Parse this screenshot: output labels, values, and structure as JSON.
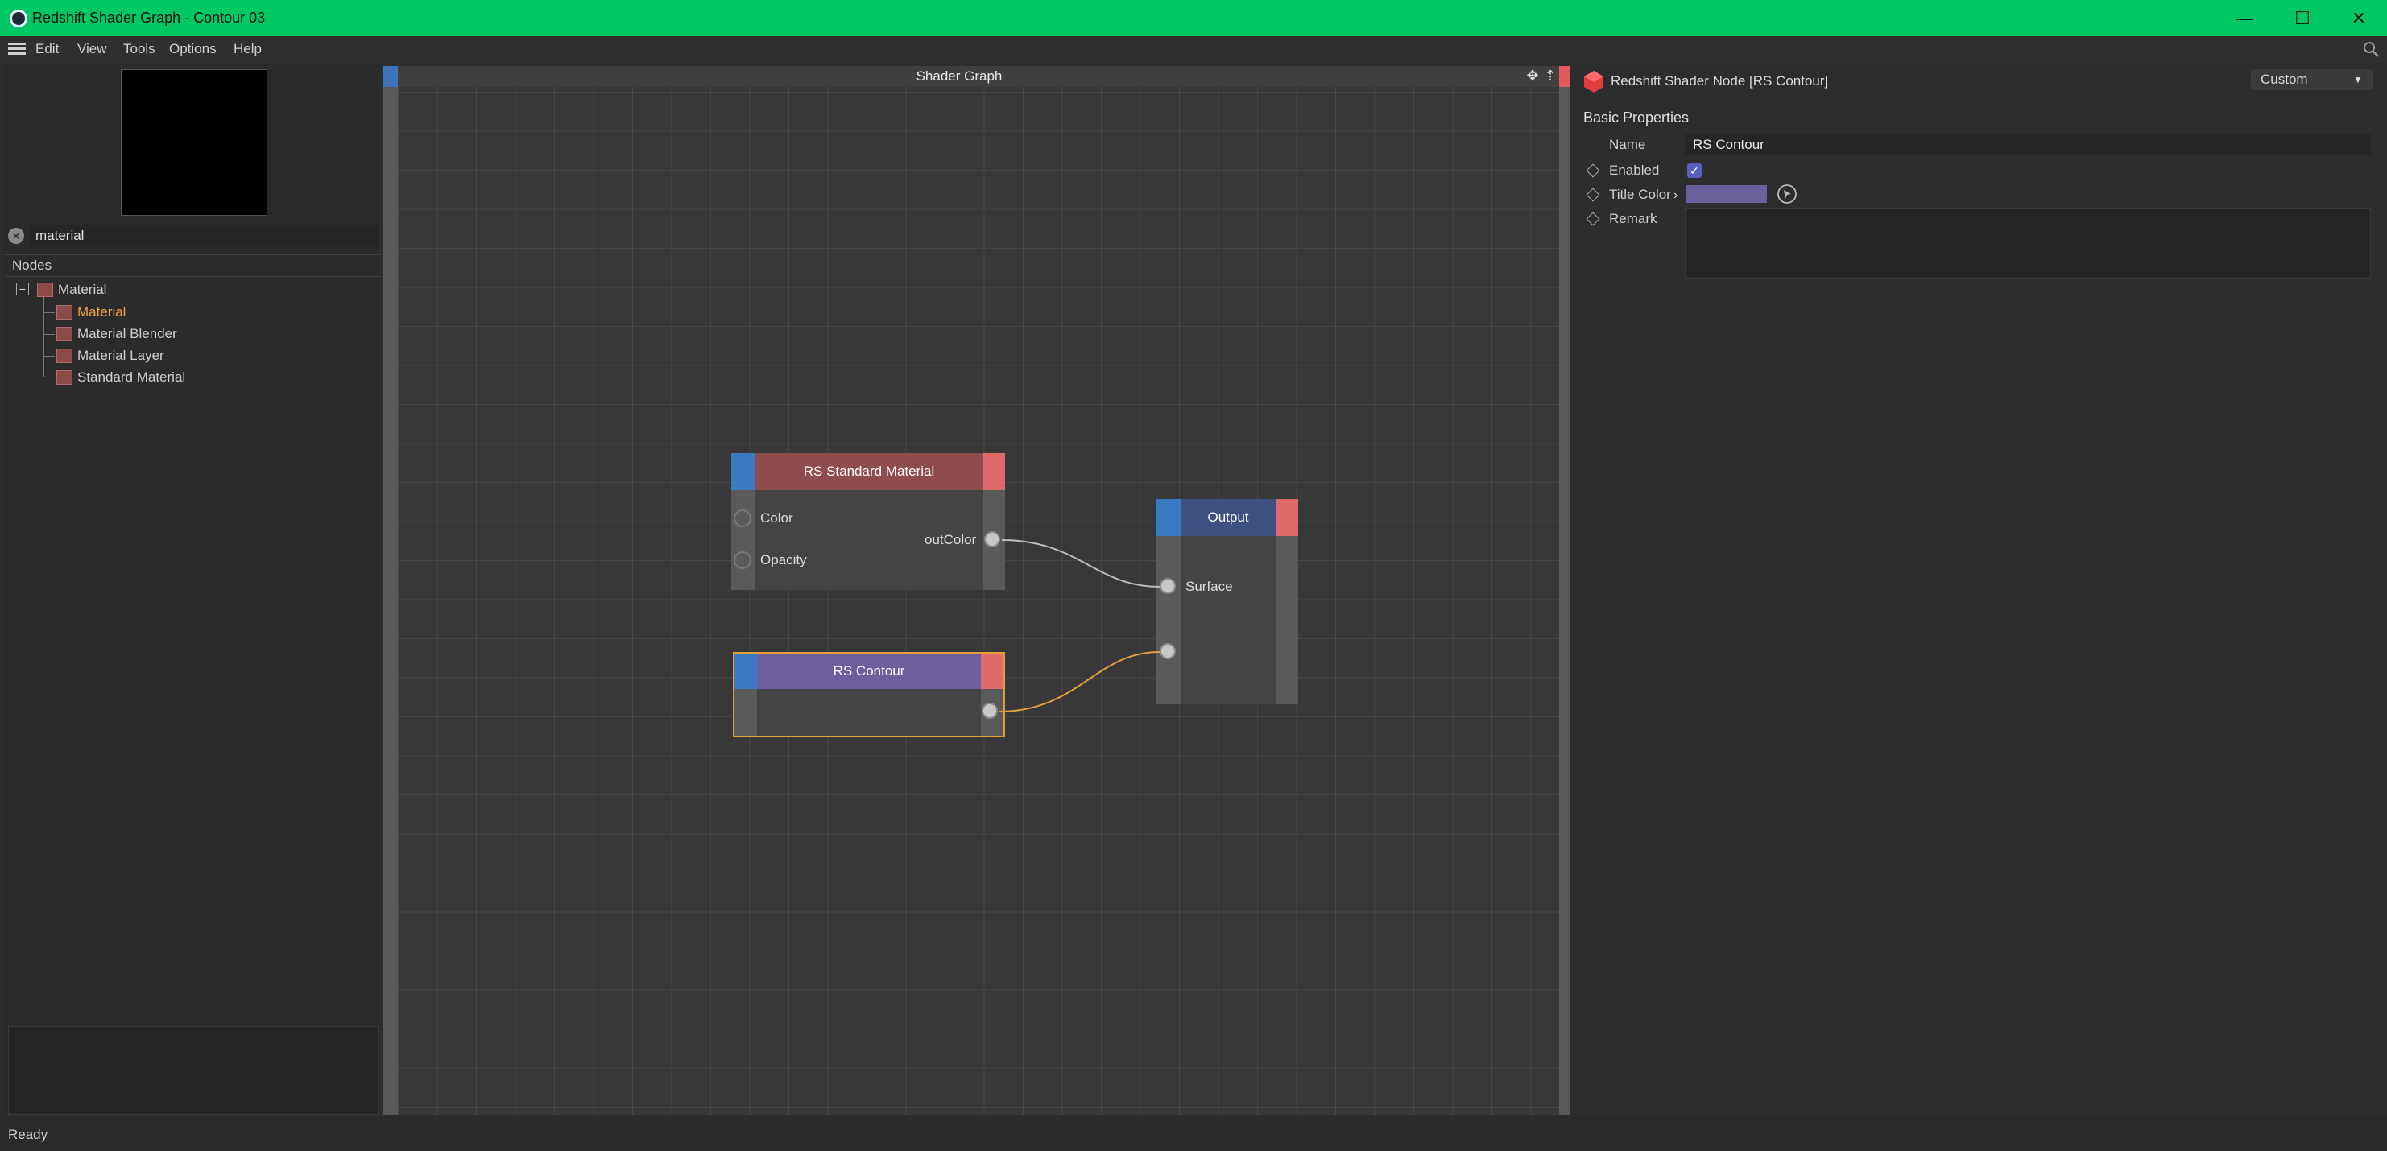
{
  "window": {
    "title": "Redshift Shader Graph - Contour 03",
    "minimize": "—",
    "maximize": "☐",
    "close": "✕"
  },
  "menu": {
    "items": [
      "Edit",
      "View",
      "Tools",
      "Options",
      "Help"
    ]
  },
  "left_panel": {
    "search_value": "material",
    "nodes_header": "Nodes",
    "tree": {
      "root": "Material",
      "children": [
        "Material",
        "Material Blender",
        "Material Layer",
        "Standard Material"
      ],
      "selected_child": "Material"
    }
  },
  "graph": {
    "title": "Shader Graph",
    "nodes": {
      "standard_material": {
        "title": "RS Standard Material",
        "inputs": [
          "Color",
          "Opacity"
        ],
        "output": "outColor"
      },
      "output": {
        "title": "Output",
        "inputs": [
          "Surface"
        ]
      },
      "contour": {
        "title": "RS Contour",
        "selected": true
      }
    },
    "colors": {
      "standard_material_header": "#8f4c4c",
      "output_header": "#3d5183",
      "contour_header": "#6e5e9e",
      "selection": "#e0a13a",
      "wire": "#bdbdbd",
      "wire_selected": "#e0a13a"
    }
  },
  "properties": {
    "header": "Redshift Shader Node [RS Contour]",
    "mode": "Custom",
    "section": "Basic Properties",
    "name_label": "Name",
    "name_value": "RS Contour",
    "enabled_label": "Enabled",
    "enabled": true,
    "title_color_label": "Title Color",
    "title_color": "#6b5f9c",
    "remark_label": "Remark",
    "remark_value": ""
  },
  "status": {
    "text": "Ready"
  }
}
